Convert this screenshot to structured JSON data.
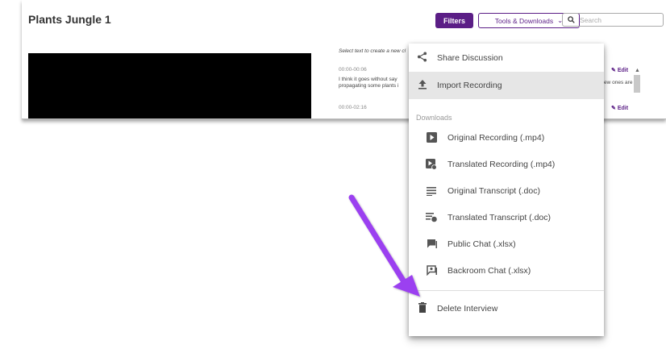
{
  "header": {
    "title": "Plants Jungle 1",
    "filters_label": "Filters",
    "tools_label": "Tools & Downloads",
    "search_placeholder": "Search"
  },
  "transcript": {
    "hint": "Select text to create a new cl",
    "entry1_time": "00:00-00:06",
    "entry1_line1": "I think it goes without say",
    "entry1_line2": "propagating some plants i",
    "entry1_line_right": "e new ones are",
    "entry2_time": "00:00-02:16",
    "edit_label": "Edit"
  },
  "menu": {
    "share_label": "Share Discussion",
    "import_label": "Import Recording",
    "downloads_heading": "Downloads",
    "downloads": [
      {
        "label": "Original Recording (.mp4)",
        "icon": "play-icon"
      },
      {
        "label": "Translated Recording (.mp4)",
        "icon": "translated-video-icon"
      },
      {
        "label": "Original Transcript (.doc)",
        "icon": "lines-icon"
      },
      {
        "label": "Translated Transcript (.doc)",
        "icon": "translated-lines-icon"
      },
      {
        "label": "Public Chat (.xlsx)",
        "icon": "chat-icon"
      },
      {
        "label": "Backroom Chat (.xlsx)",
        "icon": "backroom-chat-icon"
      }
    ],
    "delete_label": "Delete Interview"
  },
  "colors": {
    "brand_purple": "#5b1e86",
    "annotation_arrow": "#9b3ff0"
  }
}
